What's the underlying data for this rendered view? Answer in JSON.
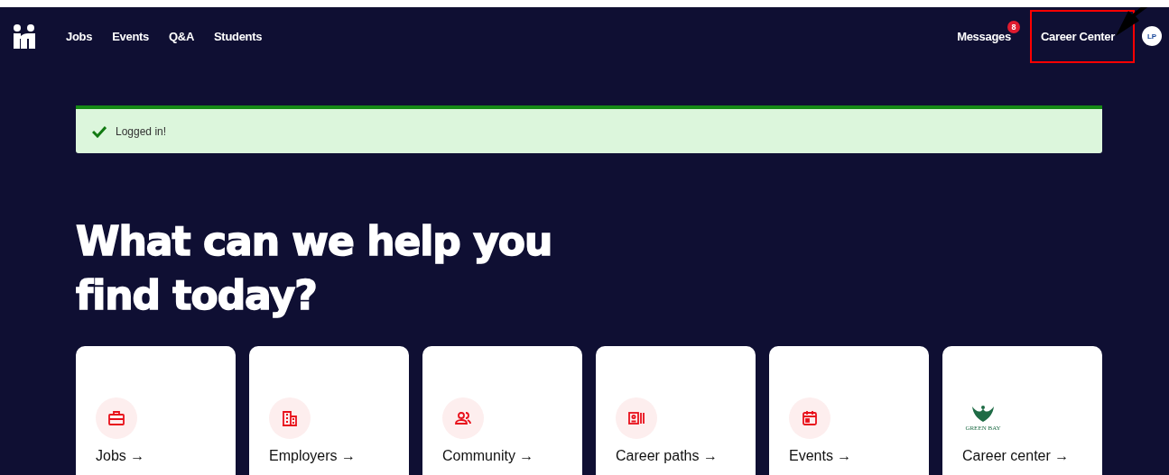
{
  "nav": {
    "links": [
      {
        "label": "Jobs"
      },
      {
        "label": "Events"
      },
      {
        "label": "Q&A"
      },
      {
        "label": "Students"
      }
    ],
    "right": [
      {
        "label": "Messages",
        "badge": "8",
        "highlighted": false
      },
      {
        "label": "Career Center",
        "highlighted": true
      }
    ],
    "avatar": "LP"
  },
  "alert": {
    "message": "Logged in!"
  },
  "heading": "What can we help you find today?",
  "cards": [
    {
      "kind": "briefcase",
      "label": "Jobs →"
    },
    {
      "kind": "building",
      "label": "Employers →"
    },
    {
      "kind": "people",
      "label": "Community →"
    },
    {
      "kind": "id-card",
      "label": "Career paths →"
    },
    {
      "kind": "calendar",
      "label": "Events →"
    },
    {
      "kind": "logo",
      "label": "Career center →",
      "logo_text": "GREEN BAY"
    }
  ]
}
